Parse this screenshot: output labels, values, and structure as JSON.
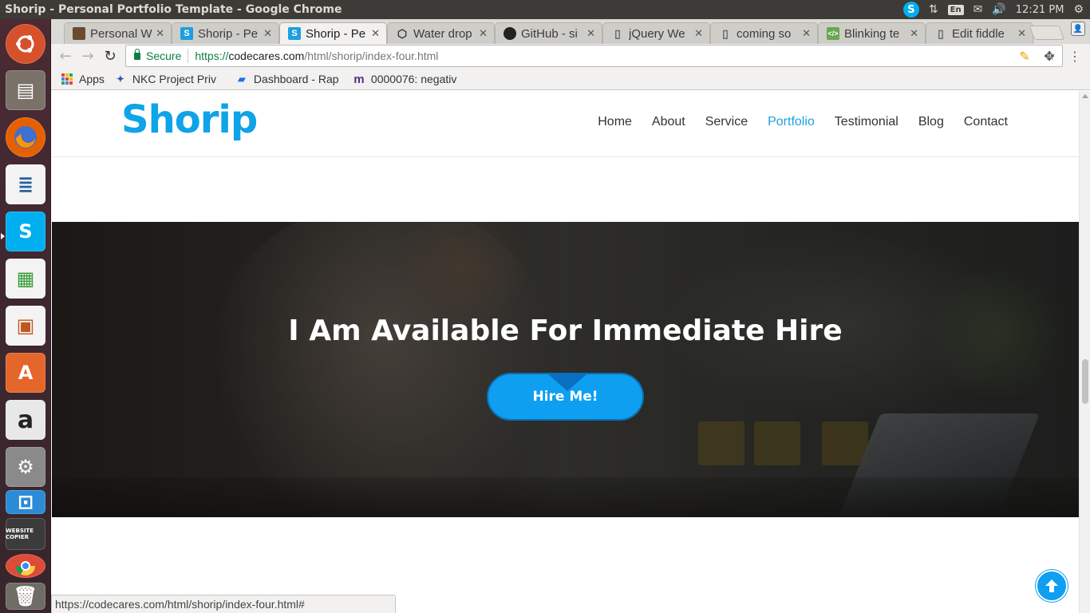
{
  "os_panel": {
    "window_title": "Shorip - Personal Portfolio Template - Google Chrome",
    "lang": "En",
    "clock": "12:21 PM",
    "icons": [
      "skype-icon",
      "network-arrows-icon",
      "mail-icon",
      "volume-icon",
      "gear-icon"
    ]
  },
  "launcher": {
    "items": [
      {
        "name": "ubuntu-dash-icon",
        "color": "#d6512b"
      },
      {
        "name": "files-icon",
        "color": "#7a7269"
      },
      {
        "name": "firefox-icon",
        "color": "#e66000"
      },
      {
        "name": "writer-icon",
        "color": "#2a5f9e"
      },
      {
        "name": "skype-icon",
        "color": "#00aff0"
      },
      {
        "name": "calc-icon",
        "color": "#3a9b3a"
      },
      {
        "name": "impress-icon",
        "color": "#c2561e"
      },
      {
        "name": "software-center-icon",
        "color": "#e4662b"
      },
      {
        "name": "amazon-icon",
        "color": "#e8e8e8"
      },
      {
        "name": "settings-icon",
        "color": "#8a8a8a"
      },
      {
        "name": "remote-desktop-icon",
        "color": "#2b8bd6"
      },
      {
        "name": "website-copier-icon",
        "color": "#555555"
      },
      {
        "name": "chrome-icon",
        "color": "#dd4b39"
      }
    ],
    "website_copier_label": "WEBSITE COPIER"
  },
  "tabs": [
    {
      "title": "Personal W",
      "icon": "personal-site-favicon",
      "icon_color": "#6b4a2e",
      "active": false
    },
    {
      "title": "Shorip - Pe",
      "icon": "shorip-favicon",
      "icon_color": "#1d9fe0",
      "active": false
    },
    {
      "title": "Shorip - Pe",
      "icon": "shorip-favicon",
      "icon_color": "#1d9fe0",
      "active": true
    },
    {
      "title": "Water drop",
      "icon": "codepen-icon",
      "icon_color": "#333333",
      "active": false
    },
    {
      "title": "GitHub - si",
      "icon": "github-icon",
      "icon_color": "#222222",
      "active": false
    },
    {
      "title": "jQuery We",
      "icon": "page-icon",
      "icon_color": "#666666",
      "active": false
    },
    {
      "title": "coming so",
      "icon": "page-icon",
      "icon_color": "#666666",
      "active": false
    },
    {
      "title": "Blinking te",
      "icon": "code-icon",
      "icon_color": "#6aa84f",
      "active": false
    },
    {
      "title": "Edit fiddle",
      "icon": "page-icon",
      "icon_color": "#666666",
      "active": false
    }
  ],
  "omnibox": {
    "secure_label": "Secure",
    "url_proto": "https://",
    "url_host": "codecares.com",
    "url_path": "/html/shorip/index-four.html"
  },
  "bookmarks": [
    {
      "label": "Apps",
      "icon": "apps-grid-icon"
    },
    {
      "label": "NKC Project Priv",
      "icon": "nkc-icon"
    },
    {
      "label": "Dashboard - Rap",
      "icon": "dashboard-icon"
    },
    {
      "label": "0000076: negativ",
      "icon": "mantis-icon"
    }
  ],
  "site": {
    "logo": "Shorip",
    "nav": [
      {
        "label": "Home",
        "active": false
      },
      {
        "label": "About",
        "active": false
      },
      {
        "label": "Service",
        "active": false
      },
      {
        "label": "Portfolio",
        "active": true
      },
      {
        "label": "Testimonial",
        "active": false
      },
      {
        "label": "Blog",
        "active": false
      },
      {
        "label": "Contact",
        "active": false
      }
    ],
    "hero_title": "I Am Available For Immediate Hire",
    "hire_button": "Hire Me!",
    "accent": "#0e9ff0"
  },
  "status_bar": {
    "text": "https://codecares.com/html/shorip/index-four.html#"
  }
}
